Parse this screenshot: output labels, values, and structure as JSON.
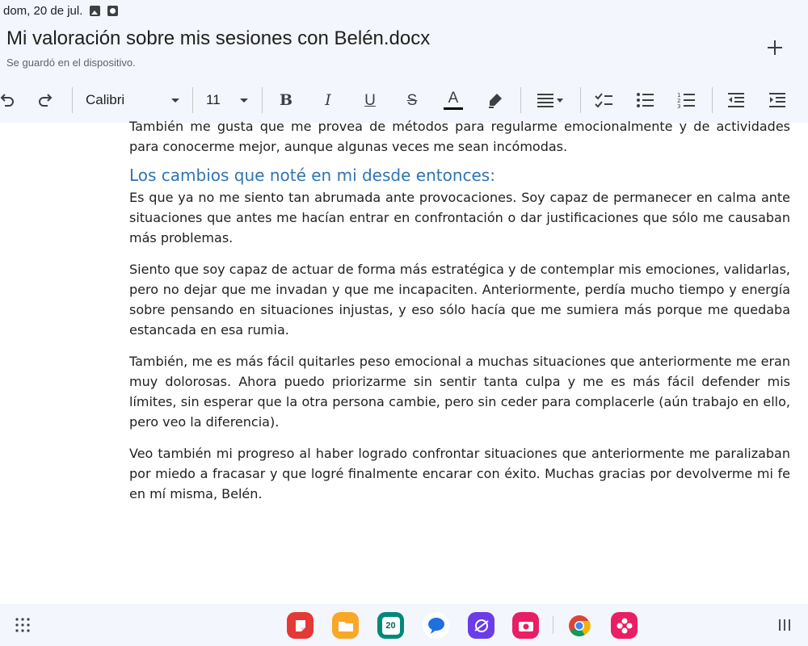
{
  "status_bar": {
    "datetime": "dom, 20 de jul."
  },
  "header": {
    "title": "Mi valoración sobre mis sesiones con Belén.docx",
    "save_status": "Se guardó en el dispositivo."
  },
  "toolbar": {
    "font_family": "Calibri",
    "font_size": "11",
    "bold_label": "B",
    "italic_label": "I",
    "underline_label": "U",
    "strike_label": "S",
    "text_color_label": "A",
    "text_color": "#000000"
  },
  "document": {
    "paragraphs_before": [
      "También me gusta que me provea de métodos para regularme emocionalmente y de actividades para conocerme mejor, aunque algunas veces me sean incómodas."
    ],
    "heading": "Los cambios que noté en mi desde entonces:",
    "heading_color": "#2e74b5",
    "paragraphs": [
      "Es que ya no me siento tan abrumada ante provocaciones. Soy capaz de permanecer en calma ante situaciones que antes me hacían entrar en confrontación o dar justificaciones que sólo me causaban más problemas.",
      "Siento que soy capaz de actuar de forma más estratégica y de contemplar mis emociones, validarlas, pero no dejar que me invadan y que me incapaciten. Anteriormente, perdía mucho tiempo y energía sobre pensando en situaciones injustas, y eso sólo hacía que me sumiera más porque me quedaba estancada en esa rumia.",
      "También, me es más fácil quitarles peso emocional a muchas situaciones que anteriormente me eran muy dolorosas. Ahora puedo priorizarme sin sentir tanta culpa y me es más fácil defender mis límites, sin esperar que la otra persona cambie, pero sin ceder para complacerle (aún trabajo en ello, pero veo la diferencia).",
      "Veo también mi progreso al haber logrado confrontar situaciones que anteriormente me paralizaban por miedo a fracasar y que logré finalmente encarar con éxito. Muchas gracias por devolverme mi fe en mí misma, Belén."
    ]
  },
  "dock": {
    "calendar_day": "20",
    "apps": [
      {
        "name": "notes-app",
        "color": "#e53935"
      },
      {
        "name": "files-app",
        "color": "#f9a825"
      },
      {
        "name": "calendar-app",
        "color": "#00897b"
      },
      {
        "name": "messages-app",
        "color": "#1e6fe0"
      },
      {
        "name": "internet-app",
        "color": "#6a3de8"
      },
      {
        "name": "screen-recorder-app",
        "color": "#e91e63"
      },
      {
        "name": "chrome-app",
        "color": "#ffffff"
      },
      {
        "name": "gallery-app",
        "color": "#e91e63"
      }
    ]
  }
}
